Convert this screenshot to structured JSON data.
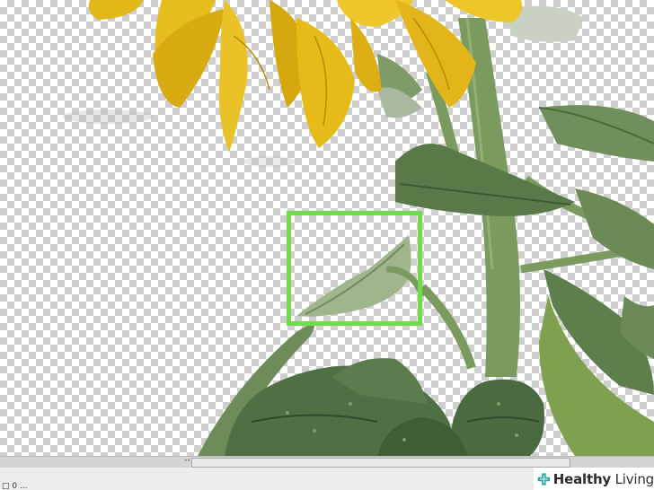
{
  "status": {
    "text": "□ 0 ..."
  },
  "watermark": {
    "brand_bold": "Healthy",
    "brand_light": "Living",
    "icon": "plus-cross-icon",
    "color": "#2aa9a0"
  },
  "highlight": {
    "color": "#6fdc4a"
  },
  "scrollbar": {
    "grip_glyph": "••"
  }
}
